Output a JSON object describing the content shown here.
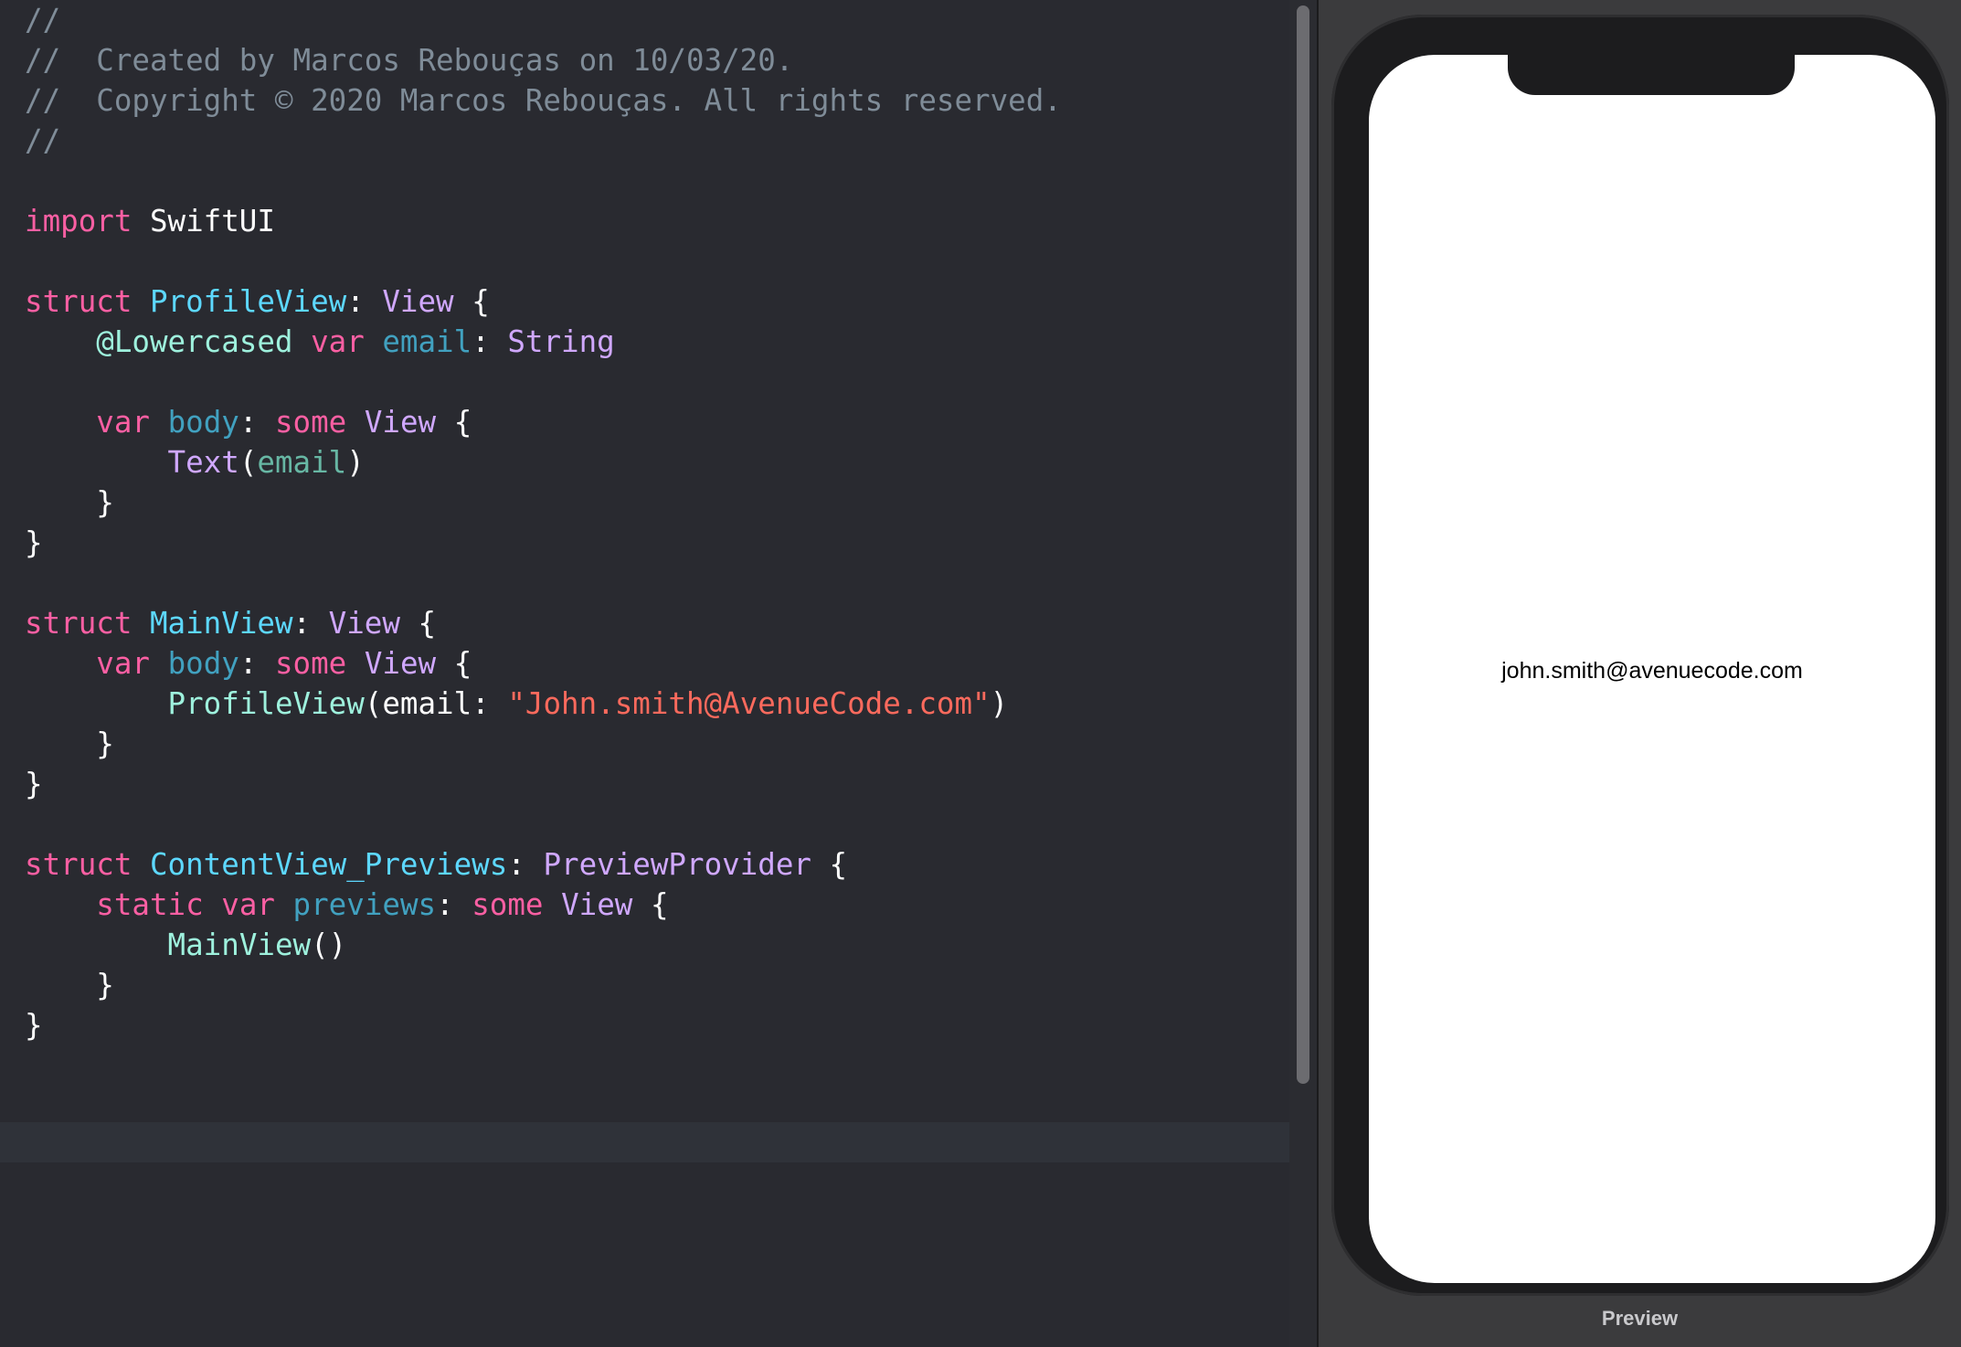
{
  "editor": {
    "lines": [
      {
        "tokens": [
          {
            "text": "//",
            "cls": "t-comment"
          }
        ]
      },
      {
        "tokens": [
          {
            "text": "//  Created by Marcos Rebouças on 10/03/20.",
            "cls": "t-comment"
          }
        ]
      },
      {
        "tokens": [
          {
            "text": "//  Copyright © 2020 Marcos Rebouças. All rights reserved.",
            "cls": "t-comment"
          }
        ]
      },
      {
        "tokens": [
          {
            "text": "//",
            "cls": "t-comment"
          }
        ]
      },
      {
        "tokens": []
      },
      {
        "tokens": [
          {
            "text": "import",
            "cls": "t-keyword"
          },
          {
            "text": " SwiftUI",
            "cls": "t-plain"
          }
        ]
      },
      {
        "tokens": []
      },
      {
        "tokens": [
          {
            "text": "struct",
            "cls": "t-keyword"
          },
          {
            "text": " ",
            "cls": "t-plain"
          },
          {
            "text": "ProfileView",
            "cls": "t-typedecl"
          },
          {
            "text": ": ",
            "cls": "t-plain"
          },
          {
            "text": "View",
            "cls": "t-type"
          },
          {
            "text": " {",
            "cls": "t-plain"
          }
        ]
      },
      {
        "tokens": [
          {
            "text": "    @Lowercased",
            "cls": "t-viewcall"
          },
          {
            "text": " ",
            "cls": "t-plain"
          },
          {
            "text": "var",
            "cls": "t-keyword"
          },
          {
            "text": " ",
            "cls": "t-plain"
          },
          {
            "text": "email",
            "cls": "t-prop"
          },
          {
            "text": ": ",
            "cls": "t-plain"
          },
          {
            "text": "String",
            "cls": "t-type"
          }
        ]
      },
      {
        "tokens": []
      },
      {
        "tokens": [
          {
            "text": "    ",
            "cls": "t-plain"
          },
          {
            "text": "var",
            "cls": "t-keyword"
          },
          {
            "text": " ",
            "cls": "t-plain"
          },
          {
            "text": "body",
            "cls": "t-prop"
          },
          {
            "text": ": ",
            "cls": "t-plain"
          },
          {
            "text": "some",
            "cls": "t-keyword"
          },
          {
            "text": " ",
            "cls": "t-plain"
          },
          {
            "text": "View",
            "cls": "t-type"
          },
          {
            "text": " {",
            "cls": "t-plain"
          }
        ]
      },
      {
        "tokens": [
          {
            "text": "        ",
            "cls": "t-plain"
          },
          {
            "text": "Text",
            "cls": "t-call"
          },
          {
            "text": "(",
            "cls": "t-plain"
          },
          {
            "text": "email",
            "cls": "t-var"
          },
          {
            "text": ")",
            "cls": "t-plain"
          }
        ]
      },
      {
        "tokens": [
          {
            "text": "    }",
            "cls": "t-plain"
          }
        ]
      },
      {
        "tokens": [
          {
            "text": "}",
            "cls": "t-plain"
          }
        ]
      },
      {
        "tokens": []
      },
      {
        "tokens": [
          {
            "text": "struct",
            "cls": "t-keyword"
          },
          {
            "text": " ",
            "cls": "t-plain"
          },
          {
            "text": "MainView",
            "cls": "t-typedecl"
          },
          {
            "text": ": ",
            "cls": "t-plain"
          },
          {
            "text": "View",
            "cls": "t-type"
          },
          {
            "text": " {",
            "cls": "t-plain"
          }
        ]
      },
      {
        "tokens": [
          {
            "text": "    ",
            "cls": "t-plain"
          },
          {
            "text": "var",
            "cls": "t-keyword"
          },
          {
            "text": " ",
            "cls": "t-plain"
          },
          {
            "text": "body",
            "cls": "t-prop"
          },
          {
            "text": ": ",
            "cls": "t-plain"
          },
          {
            "text": "some",
            "cls": "t-keyword"
          },
          {
            "text": " ",
            "cls": "t-plain"
          },
          {
            "text": "View",
            "cls": "t-type"
          },
          {
            "text": " {",
            "cls": "t-plain"
          }
        ]
      },
      {
        "tokens": [
          {
            "text": "        ",
            "cls": "t-plain"
          },
          {
            "text": "ProfileView",
            "cls": "t-viewcall"
          },
          {
            "text": "(email: ",
            "cls": "t-plain"
          },
          {
            "text": "\"John.smith@AvenueCode.com\"",
            "cls": "t-string"
          },
          {
            "text": ")",
            "cls": "t-plain"
          }
        ]
      },
      {
        "tokens": [
          {
            "text": "    }",
            "cls": "t-plain"
          }
        ]
      },
      {
        "tokens": [
          {
            "text": "}",
            "cls": "t-plain"
          }
        ]
      },
      {
        "tokens": []
      },
      {
        "tokens": [
          {
            "text": "struct",
            "cls": "t-keyword"
          },
          {
            "text": " ",
            "cls": "t-plain"
          },
          {
            "text": "ContentView_Previews",
            "cls": "t-typedecl"
          },
          {
            "text": ": ",
            "cls": "t-plain"
          },
          {
            "text": "PreviewProvider",
            "cls": "t-type"
          },
          {
            "text": " {",
            "cls": "t-plain"
          }
        ]
      },
      {
        "tokens": [
          {
            "text": "    ",
            "cls": "t-plain"
          },
          {
            "text": "static",
            "cls": "t-keyword"
          },
          {
            "text": " ",
            "cls": "t-plain"
          },
          {
            "text": "var",
            "cls": "t-keyword"
          },
          {
            "text": " ",
            "cls": "t-plain"
          },
          {
            "text": "previews",
            "cls": "t-prop"
          },
          {
            "text": ": ",
            "cls": "t-plain"
          },
          {
            "text": "some",
            "cls": "t-keyword"
          },
          {
            "text": " ",
            "cls": "t-plain"
          },
          {
            "text": "View",
            "cls": "t-type"
          },
          {
            "text": " {",
            "cls": "t-plain"
          }
        ]
      },
      {
        "tokens": [
          {
            "text": "        ",
            "cls": "t-plain"
          },
          {
            "text": "MainView",
            "cls": "t-viewcall"
          },
          {
            "text": "()",
            "cls": "t-plain"
          }
        ]
      },
      {
        "tokens": [
          {
            "text": "    }",
            "cls": "t-plain"
          }
        ]
      },
      {
        "tokens": [
          {
            "text": "}",
            "cls": "t-plain"
          }
        ]
      }
    ]
  },
  "preview": {
    "email_text": "john.smith@avenuecode.com",
    "label": "Preview"
  },
  "colors": {
    "editor_background": "#292a30",
    "keyword": "#fc5fa3",
    "type_declaration": "#5dd8ff",
    "other_type": "#d0a8ff",
    "string": "#fc6a5d",
    "comment": "#7f8c98"
  }
}
